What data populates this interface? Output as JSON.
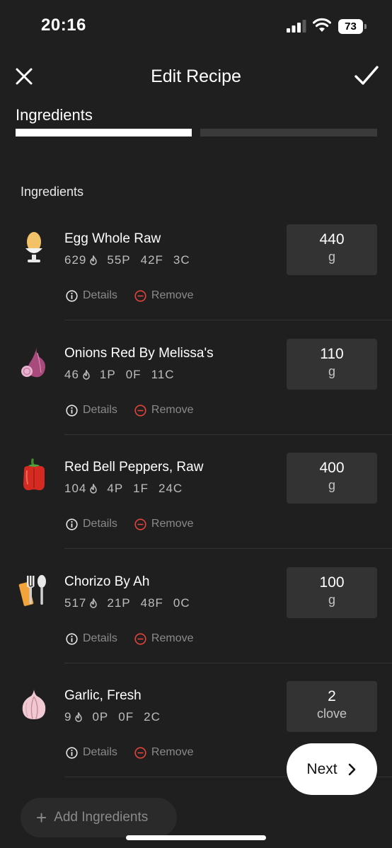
{
  "status": {
    "time": "20:16",
    "battery": "73"
  },
  "nav": {
    "title": "Edit Recipe",
    "close_icon": "close-icon",
    "confirm_icon": "checkmark-icon"
  },
  "step": {
    "label": "Ingredients",
    "current": 1,
    "total": 2
  },
  "section": {
    "title": "Ingredients"
  },
  "ingredients": [
    {
      "name": "Egg Whole Raw",
      "calories": "629",
      "protein": "55P",
      "fat": "42F",
      "carbs": "3C",
      "qty": "440",
      "unit": "g",
      "icon": "egg-icon"
    },
    {
      "name": "Onions Red By Melissa's",
      "calories": "46",
      "protein": "1P",
      "fat": "0F",
      "carbs": "11C",
      "qty": "110",
      "unit": "g",
      "icon": "onion-icon"
    },
    {
      "name": "Red Bell Peppers, Raw",
      "calories": "104",
      "protein": "4P",
      "fat": "1F",
      "carbs": "24C",
      "qty": "400",
      "unit": "g",
      "icon": "pepper-icon"
    },
    {
      "name": "Chorizo By Ah",
      "calories": "517",
      "protein": "21P",
      "fat": "48F",
      "carbs": "0C",
      "qty": "100",
      "unit": "g",
      "icon": "utensils-icon"
    },
    {
      "name": "Garlic, Fresh",
      "calories": "9",
      "protein": "0P",
      "fat": "0F",
      "carbs": "2C",
      "qty": "2",
      "unit": "clove",
      "icon": "garlic-icon"
    }
  ],
  "actions": {
    "details": "Details",
    "remove": "Remove"
  },
  "buttons": {
    "next": "Next",
    "add_ingredients": "Add Ingredients"
  },
  "colors": {
    "background": "#1f1f1f",
    "card": "#333333",
    "remove_accent": "#e0443a"
  }
}
